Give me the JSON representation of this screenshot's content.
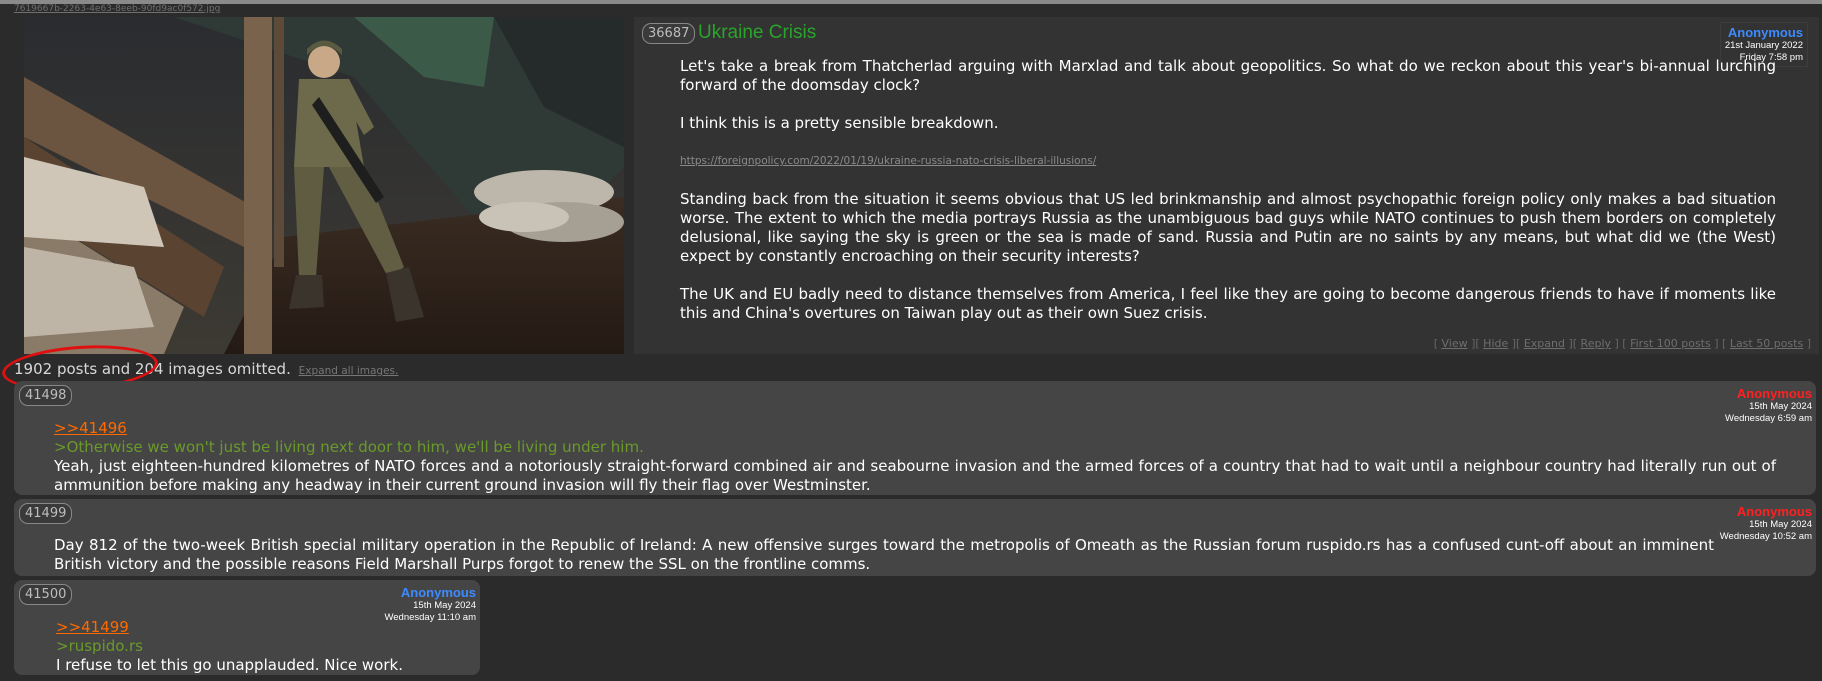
{
  "file_name": "7619667b-2263-4e63-8eeb-90fd9ac0f572.jpg",
  "op": {
    "post_number": "36687",
    "title": "Ukraine Crisis",
    "author": "Anonymous",
    "date": "21st January 2022",
    "time": "Friday 7:58 pm",
    "paragraph_1": "Let's take a break from Thatcherlad arguing with Marxlad and talk about geopolitics. So what do we reckon about this year's bi-annual lurching forward of the doomsday clock?",
    "paragraph_2": "I think this is a pretty sensible breakdown.",
    "link": "https://foreignpolicy.com/2022/01/19/ukraine-russia-nato-crisis-liberal-illusions/",
    "paragraph_3": "Standing back from the situation it seems obvious that US led brinkmanship and almost psychopathic foreign policy only makes a bad situation worse. The extent to which the media portrays Russia as the unambiguous bad guys while NATO continues to push them borders on completely delusional, like saying the sky is green or the sea is made of sand. Russia and Putin are no saints by any means, but what did we (the West) expect by constantly encroaching on their security interests?",
    "paragraph_4": "The UK and EU badly need to distance themselves from America, I feel like they are going to become dangerous friends to have if moments like this and China's overtures on Taiwan play out as their own Suez crisis.",
    "actions": {
      "view": "View",
      "hide": "Hide",
      "expand": "Expand",
      "reply": "Reply",
      "first_100": "First 100 posts",
      "last_50": "Last 50 posts"
    }
  },
  "omitted": {
    "text": "1902 posts and 204 images omitted.",
    "expand_label": "Expand all images."
  },
  "replies": [
    {
      "post_number": "41498",
      "author": "Anonymous",
      "date": "15th May 2024",
      "time": "Wednesday 6:59 am",
      "quote_link": ">>41496",
      "greentext": ">Otherwise we won't just be living next door to him, we'll be living under him.",
      "text": "Yeah, just eighteen-hundred kilometres of NATO forces and a notoriously straight-forward combined air and seabourne invasion and the armed forces of a country that had to wait until a neighbour country had literally run out of ammunition before making any headway in their current ground invasion will fly their flag over Westminster."
    },
    {
      "post_number": "41499",
      "author": "Anonymous",
      "date": "15th May 2024",
      "time": "Wednesday 10:52 am",
      "text": "Day 812 of the two-week British special military operation in the Republic of Ireland: A new offensive surges toward the metropolis of Omeath as the Russian forum ruspido.rs has a confused cunt-off about an imminent British victory and the possible reasons Field Marshall Purps forgot to renew the SSL on the frontline comms."
    },
    {
      "post_number": "41500",
      "author": "Anonymous",
      "date": "15th May 2024",
      "time": "Wednesday 11:10 am",
      "quote_link": ">>41499",
      "greentext": ">ruspido.rs",
      "text": "I refuse to let this go unapplauded. Nice work."
    }
  ]
}
